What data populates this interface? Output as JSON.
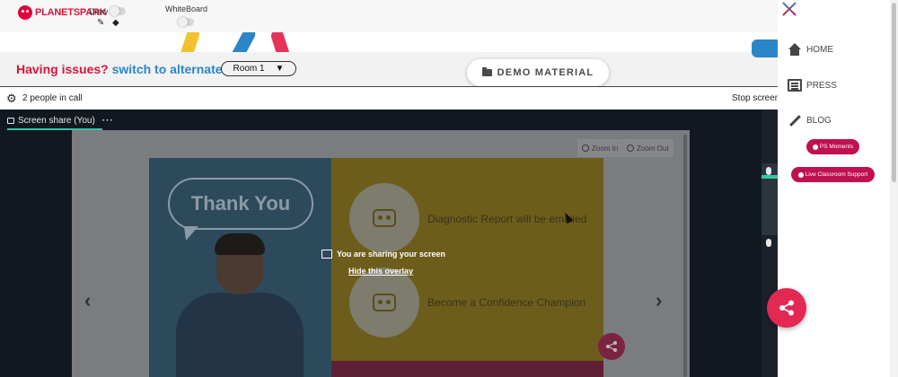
{
  "topbar": {
    "logo_text": "PLANETSPARK",
    "draw_label": "Draw",
    "whiteboard_label": "WhiteBoard"
  },
  "issues": {
    "question": "Having issues?",
    "link": "switch to alternate room",
    "room_selected": "Room 1"
  },
  "demo_material_label": "DEMO MATERIAL",
  "callbar": {
    "people_count": "2 people in call",
    "stop_screen": "Stop screen"
  },
  "screen_share": {
    "tab_label": "Screen share (You)",
    "zoom_in": "Zoom In",
    "zoom_out": "Zoom Out",
    "overlay_message": "You are sharing your screen",
    "hide_overlay": "Hide this overlay"
  },
  "slide": {
    "bubble_text": "Thank You",
    "item1": "Diagnostic Report will be emailed",
    "item2": "Become a Confidence Champion"
  },
  "nav": {
    "home": "HOME",
    "press": "PRESS",
    "blog": "BLOG",
    "ps_moments": "PS Moments",
    "live_support": "Live Classroom Support"
  },
  "colors": {
    "brand_red": "#d8143a",
    "brand_blue": "#2a86c7",
    "pink": "#c0104f",
    "accent_teal": "#36c3a6"
  },
  "icons": [
    "pencil-icon",
    "eraser-icon",
    "gear-icon",
    "folder-icon",
    "monitor-icon",
    "home-icon",
    "press-icon",
    "pencil-blog-icon",
    "close-icon",
    "share-icon",
    "mic-icon",
    "chevron-left-icon",
    "chevron-right-icon"
  ]
}
